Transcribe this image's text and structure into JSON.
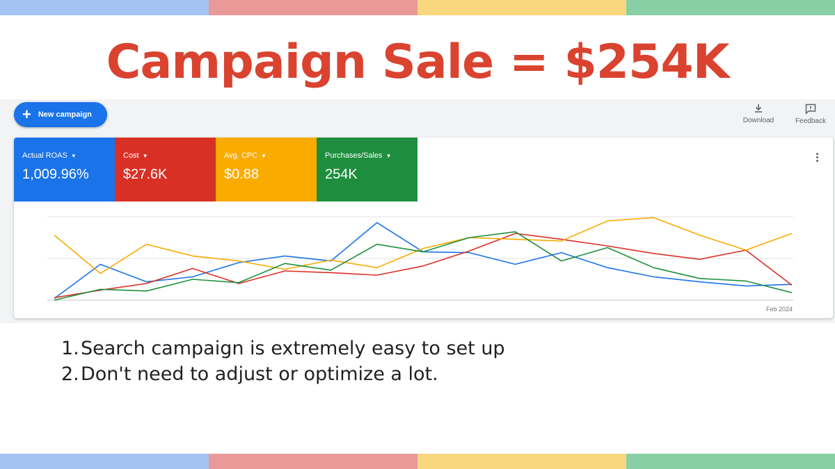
{
  "colors": {
    "blue": "#1a73e8",
    "red": "#d93025",
    "yellow": "#f9ab00",
    "green": "#1e8e3e",
    "headline": "#d9432f",
    "stripe_blue": "#a4c2f4",
    "stripe_red": "#ea9999",
    "stripe_yellow": "#f9d77e",
    "stripe_green": "#88cfa6"
  },
  "headline": "Campaign Sale = $254K",
  "toolbar": {
    "new_campaign_label": "New campaign",
    "download_label": "Download",
    "feedback_label": "Feedback"
  },
  "scorecards": [
    {
      "label": "Actual ROAS",
      "value": "1,009.96%",
      "color": "#1a73e8"
    },
    {
      "label": "Cost",
      "value": "$27.6K",
      "color": "#d93025"
    },
    {
      "label": "Avg. CPC",
      "value": "$0.88",
      "color": "#f9ab00"
    },
    {
      "label": "Purchases/Sales",
      "value": "254K",
      "color": "#1e8e3e"
    }
  ],
  "chart_data": {
    "type": "line",
    "x_tick_label": "Feb 2024",
    "grid": true,
    "ylim": [
      0,
      100
    ],
    "series": [
      {
        "color": "#1a73e8",
        "values": [
          2,
          43,
          22,
          28,
          45,
          53,
          47,
          93,
          58,
          57,
          43,
          57,
          39,
          28,
          22,
          17,
          19
        ]
      },
      {
        "color": "#d93025",
        "values": [
          3,
          12,
          20,
          38,
          20,
          35,
          33,
          30,
          41,
          59,
          80,
          73,
          65,
          56,
          49,
          60,
          18
        ]
      },
      {
        "color": "#f9ab00",
        "values": [
          78,
          32,
          67,
          53,
          47,
          37,
          48,
          39,
          62,
          75,
          73,
          71,
          95,
          99,
          78,
          60,
          80
        ]
      },
      {
        "color": "#1e8e3e",
        "values": [
          0,
          13,
          11,
          25,
          21,
          44,
          36,
          67,
          58,
          75,
          82,
          47,
          63,
          39,
          26,
          23,
          9
        ]
      }
    ]
  },
  "notes": [
    {
      "num": "1.",
      "text": "Search campaign is extremely easy to set up"
    },
    {
      "num": "2.",
      "text": "Don't need to adjust or optimize a lot."
    }
  ]
}
